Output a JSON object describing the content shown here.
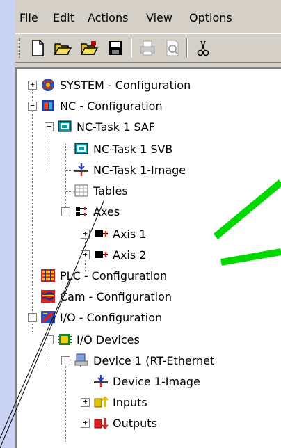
{
  "menu": {
    "file": "File",
    "edit": "Edit",
    "actions": "Actions",
    "view": "View",
    "options": "Options"
  },
  "toolbar": {
    "icons": [
      "new-icon",
      "open-icon",
      "open-project-icon",
      "save-icon",
      "print-icon",
      "print-preview-icon",
      "cut-icon"
    ]
  },
  "tree": {
    "system": "SYSTEM - Configuration",
    "nc": "NC - Configuration",
    "nc_task": "NC-Task 1 SAF",
    "nc_task_svb": "NC-Task 1 SVB",
    "nc_task_image": "NC-Task 1-Image",
    "tables": "Tables",
    "axes": "Axes",
    "axis1": "Axis 1",
    "axis2": "Axis 2",
    "plc": "PLC - Configuration",
    "cam": "Cam - Configuration",
    "io": "I/O - Configuration",
    "io_devices": "I/O Devices",
    "device1": "Device 1 (RT-Ethernet",
    "device1_image": "Device 1-Image",
    "inputs": "Inputs",
    "outputs": "Outputs"
  },
  "colors": {
    "background": "#c9d2f2",
    "highlight_arrow": "#00d800",
    "window": "#d4d0c8"
  }
}
